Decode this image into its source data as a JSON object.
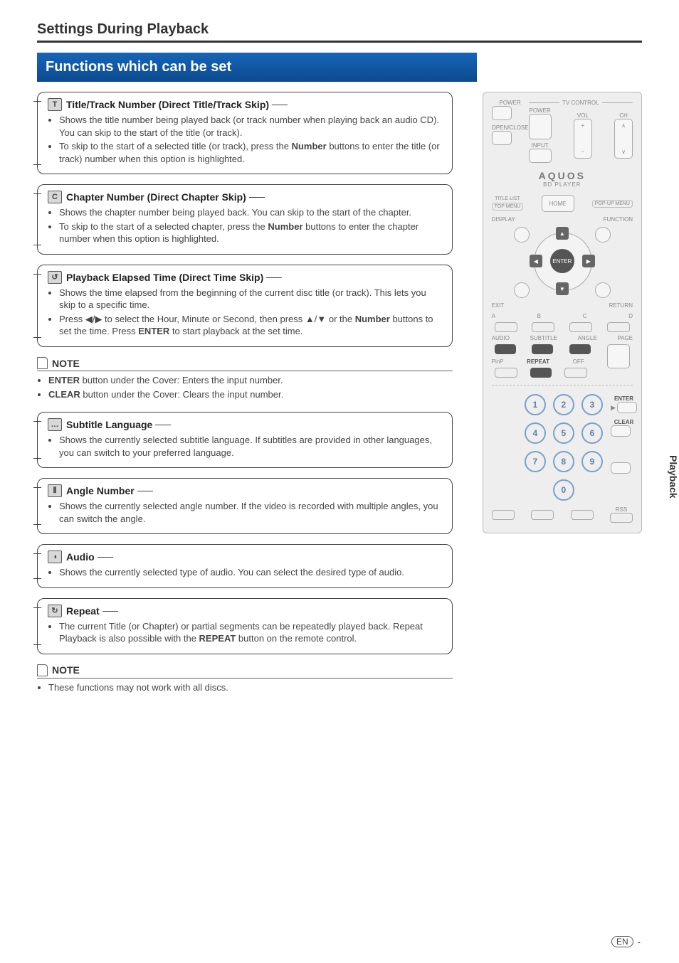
{
  "page": {
    "section_header": "Settings During Playback",
    "blue_title": "Functions which can be set",
    "side_tab": "Playback",
    "footer_lang": "EN",
    "footer_dash": "-"
  },
  "functions": [
    {
      "icon_letter": "T",
      "title": "Title/Track Number (Direct Title/Track Skip)",
      "items": [
        "Shows the title number being played back (or track number when playing back an audio CD). You can skip to the start of the title (or track).",
        "To skip to the start of a selected title (or track), press the <b>Number</b> buttons to enter the title (or track) number when this option is highlighted."
      ]
    },
    {
      "icon_letter": "C",
      "title": "Chapter Number (Direct Chapter Skip)",
      "items": [
        "Shows the chapter number being played back. You can skip to the start of the chapter.",
        "To skip to the start of a selected chapter, press the <b>Number</b> buttons to enter the chapter number when this option is highlighted."
      ]
    },
    {
      "icon_letter": "↺",
      "title": "Playback Elapsed Time (Direct Time Skip)",
      "items": [
        "Shows the time elapsed from the beginning of the current disc title (or track). This lets you skip to a specific time.",
        "Press ◀/▶ to select the Hour, Minute or Second, then press ▲/▼ or the <b>Number</b> buttons to set the time. Press <b>ENTER</b> to start playback at the set time."
      ]
    }
  ],
  "note1": {
    "label": "NOTE",
    "items": [
      "<b>ENTER</b> button under the Cover: Enters the input number.",
      "<b>CLEAR</b> button under the Cover: Clears the input number."
    ]
  },
  "functions2": [
    {
      "icon_letter": "…",
      "title": "Subtitle Language",
      "items": [
        "Shows the currently selected subtitle language. If subtitles are provided in other languages, you can switch to your preferred language."
      ]
    },
    {
      "icon_letter": "⦀",
      "title": "Angle Number",
      "items": [
        "Shows the currently selected angle number. If the video is recorded with multiple angles, you can switch the angle."
      ]
    },
    {
      "icon_letter": "◑",
      "title": "Audio",
      "items": [
        "Shows the currently selected type of audio. You can select the desired type of audio."
      ]
    },
    {
      "icon_letter": "↻",
      "title": "Repeat",
      "items": [
        "The current Title (or Chapter) or partial segments can be repeatedly played back. Repeat Playback is also possible with the <b>REPEAT</b> button on the remote control."
      ]
    }
  ],
  "note2": {
    "label": "NOTE",
    "items": [
      "These functions may not work with all discs."
    ]
  },
  "remote": {
    "tv_control": "TV CONTROL",
    "power": "POWER",
    "power2": "POWER",
    "vol": "VOL",
    "ch": "CH",
    "open_close": "OPEN/CLOSE",
    "input": "INPUT",
    "logo": "AQUOS",
    "logo_sub": "BD PLAYER",
    "title_list": "TITLE LIST",
    "top_menu": "TOP MENU",
    "home": "HOME",
    "popup_menu": "POP-UP MENU",
    "display": "DISPLAY",
    "function": "FUNCTION",
    "enter": "ENTER",
    "exit": "EXIT",
    "return": "RETURN",
    "a": "A",
    "b": "B",
    "c": "C",
    "d": "D",
    "audio": "AUDIO",
    "subtitle": "SUBTITLE",
    "angle": "ANGLE",
    "page": "PAGE",
    "pinp": "PinP",
    "repeat": "REPEAT",
    "off": "OFF",
    "enter_side": "ENTER",
    "clear_side": "CLEAR",
    "rss": "RSS"
  }
}
